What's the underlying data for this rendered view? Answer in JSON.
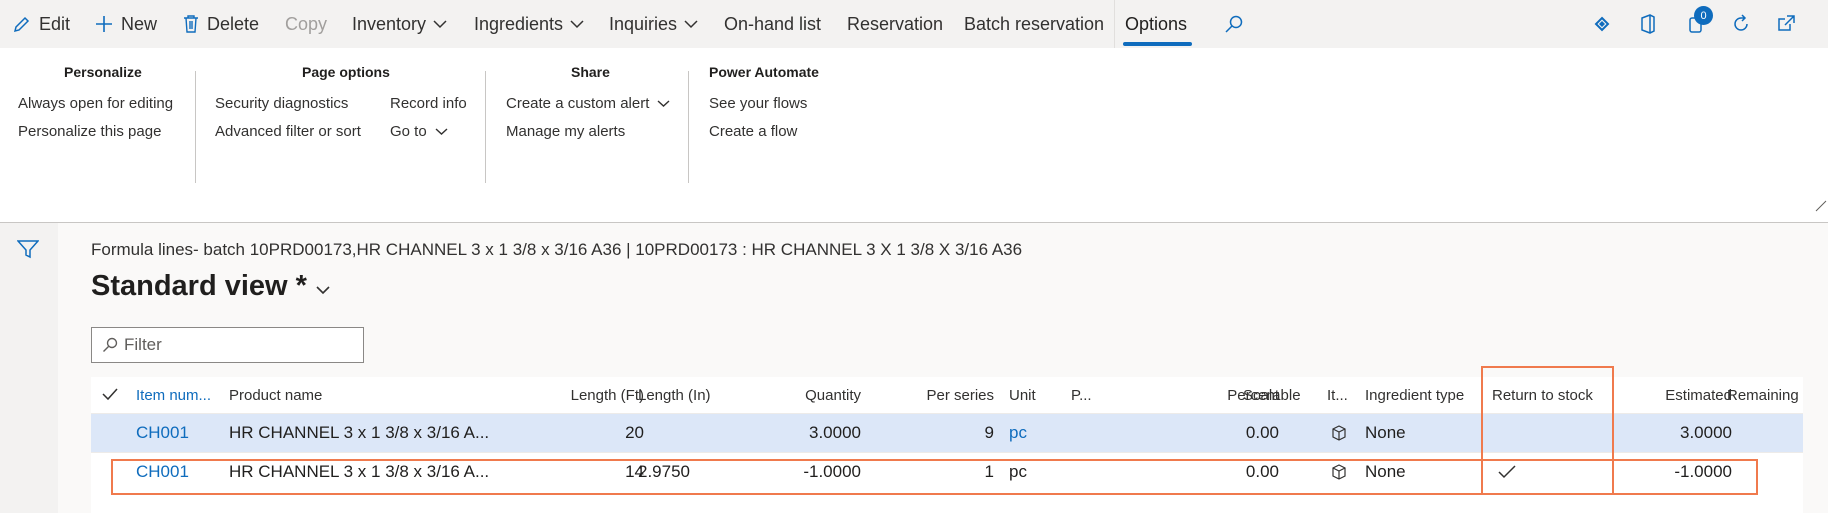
{
  "toolbar": {
    "edit": "Edit",
    "new": "New",
    "delete": "Delete",
    "copy": "Copy",
    "inventory": "Inventory",
    "ingredients": "Ingredients",
    "inquiries": "Inquiries",
    "onhand": "On-hand list",
    "reservation": "Reservation",
    "batch_reservation": "Batch reservation",
    "options": "Options",
    "notification_count": "0"
  },
  "ribbon": {
    "personalize": {
      "title": "Personalize",
      "items": [
        "Always open for editing",
        "Personalize this page"
      ]
    },
    "page_options": {
      "title": "Page options",
      "items": [
        "Security diagnostics",
        "Advanced filter or sort",
        "Record info",
        "Go to"
      ]
    },
    "share": {
      "title": "Share",
      "items": [
        "Create a custom alert",
        "Manage my alerts"
      ]
    },
    "power_automate": {
      "title": "Power Automate",
      "items": [
        "See your flows",
        "Create a flow"
      ]
    }
  },
  "page": {
    "breadcrumb": "Formula lines- batch 10PRD00173,HR CHANNEL 3 x 1 3/8 x 3/16 A36  |  10PRD00173 : HR CHANNEL 3 X 1 3/8 X 3/16 A36",
    "view_title": "Standard view *",
    "filter_placeholder": "Filter"
  },
  "grid": {
    "headers": {
      "item_number": "Item num...",
      "product_name": "Product name",
      "length_ft": "Length (Ft)",
      "length_in": "Length (In)",
      "quantity": "Quantity",
      "per_series": "Per series",
      "unit": "Unit",
      "p": "P...",
      "percent": "Percent",
      "scalable": "Scalable",
      "it": "It...",
      "ingredient_type": "Ingredient type",
      "return_to_stock": "Return to stock",
      "estimated": "Estimated",
      "remaining": "Remaining"
    },
    "rows": [
      {
        "item_number": "CH001",
        "product_name": "HR CHANNEL 3 x 1 3/8 x 3/16 A...",
        "length_ft": "20",
        "length_in": "",
        "quantity": "3.0000",
        "per_series": "9",
        "unit": "pc",
        "percent": "0.00",
        "ingredient_type": "None",
        "return_to_stock": false,
        "estimated": "3.0000"
      },
      {
        "item_number": "CH001",
        "product_name": "HR CHANNEL 3 x 1 3/8 x 3/16 A...",
        "length_ft": "14",
        "length_in": "2.9750",
        "quantity": "-1.0000",
        "per_series": "1",
        "unit": "pc",
        "percent": "0.00",
        "ingredient_type": "None",
        "return_to_stock": true,
        "estimated": "-1.0000"
      }
    ]
  },
  "colors": {
    "accent": "#0f6cbd",
    "highlight": "#f07a4d",
    "selected_row": "#dce7f8"
  }
}
